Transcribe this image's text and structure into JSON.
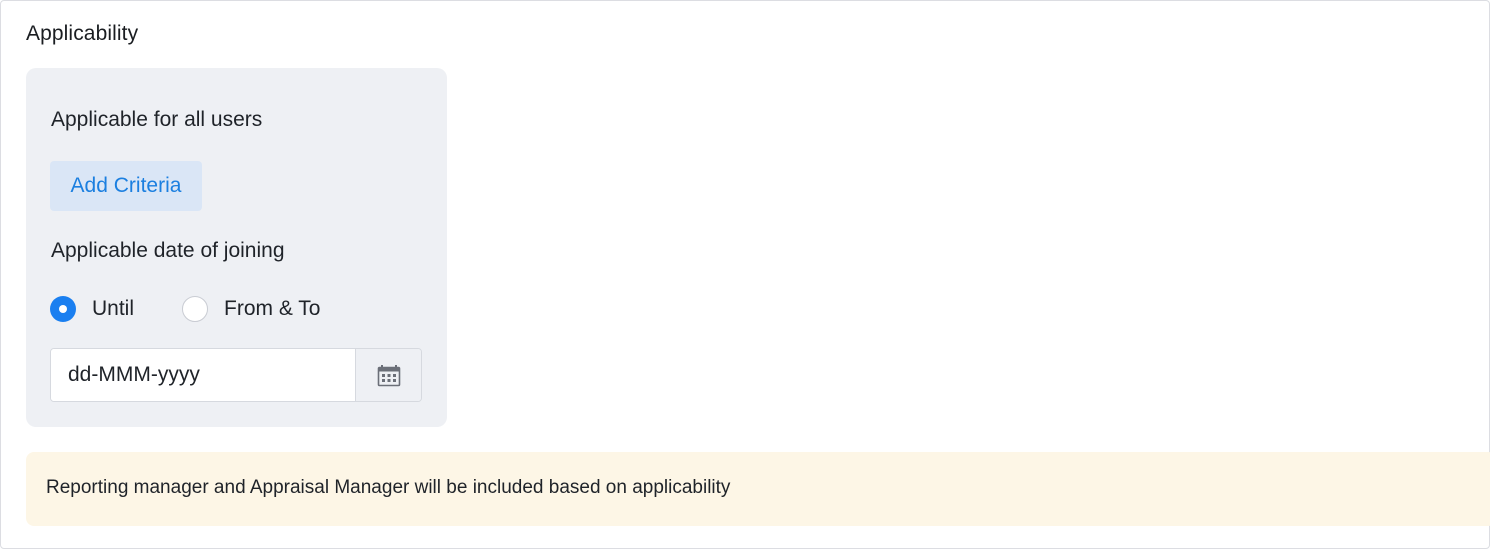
{
  "section": {
    "title": "Applicability"
  },
  "panel": {
    "applicable_label": "Applicable for all users",
    "add_criteria_label": "Add Criteria",
    "doj_label": "Applicable date of joining",
    "radio_options": [
      {
        "label": "Until",
        "checked": true
      },
      {
        "label": "From & To",
        "checked": false
      }
    ],
    "date_field": {
      "value": "",
      "placeholder": "dd-MMM-yyyy",
      "icon": "calendar-icon"
    }
  },
  "notice": {
    "text": "Reporting manager and Appraisal Manager will be included based on applicability"
  },
  "colors": {
    "accent": "#1a7ff0",
    "link_text": "#1b7fe0",
    "button_bg": "#dae6f6",
    "panel_bg": "#eef0f4",
    "notice_bg": "#fdf6e6"
  }
}
